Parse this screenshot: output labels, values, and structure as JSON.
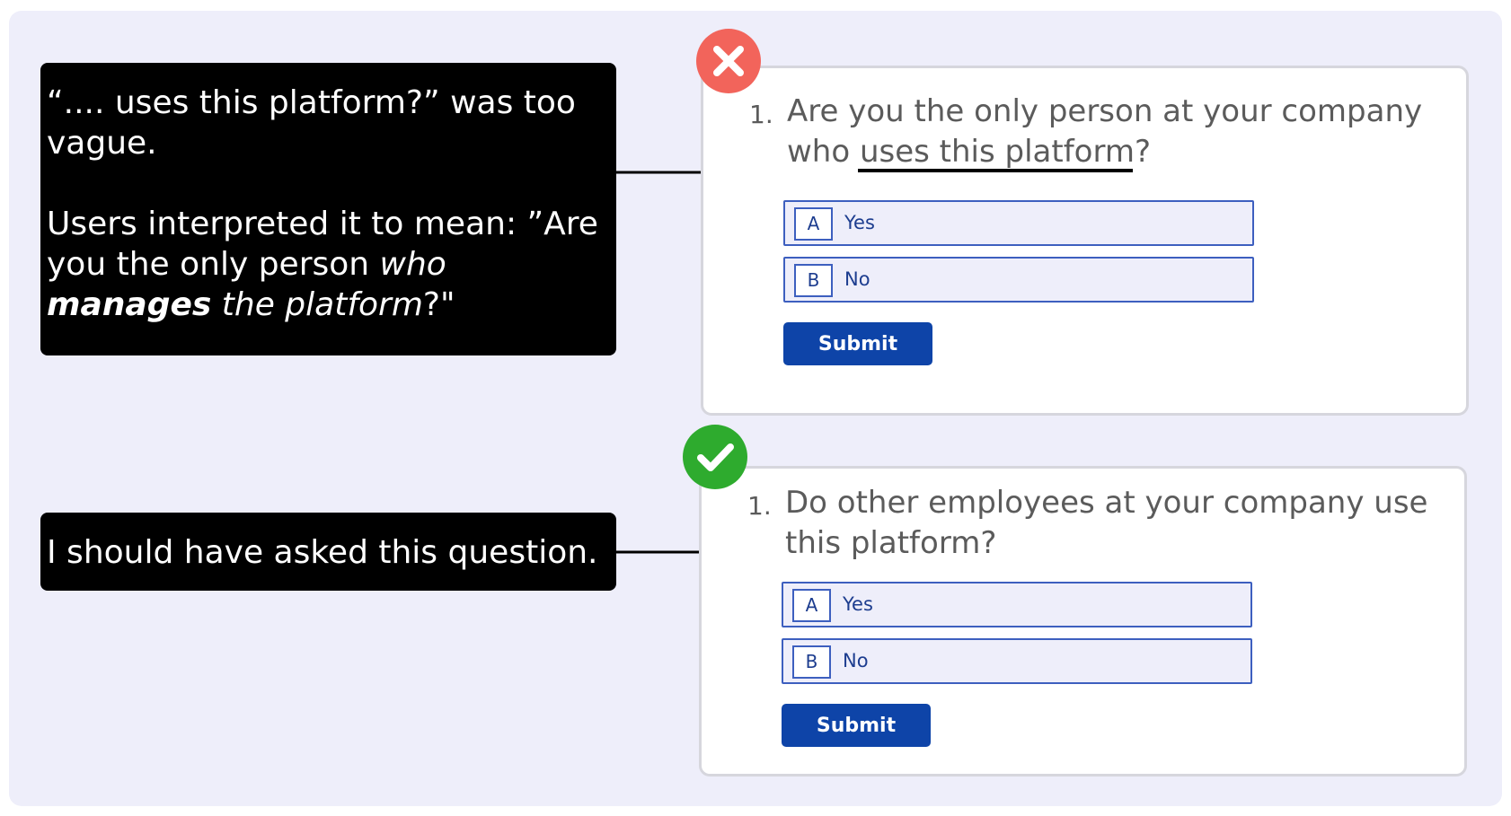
{
  "callouts": {
    "first": {
      "line1": "“.... uses this platform?” was too vague.",
      "line2_prefix": "Users interpreted it to mean: ”Are you the only person ",
      "line2_italic": "who ",
      "line2_bold_italic": "manages",
      "line2_italic_tail": " the platform",
      "line2_suffix": "?\""
    },
    "second": {
      "text": "I should have asked this question."
    }
  },
  "cards": {
    "wrong": {
      "status_icon": "x-mark-icon",
      "status_color": "#f2645b",
      "question_number": "1.",
      "question_text": "Are you the only person at your company who uses this platform?",
      "options": [
        {
          "key": "A",
          "label": "Yes"
        },
        {
          "key": "B",
          "label": "No"
        }
      ],
      "submit_label": "Submit"
    },
    "right": {
      "status_icon": "check-mark-icon",
      "status_color": "#2eab2e",
      "question_number": "1.",
      "question_text": "Do other employees at your company use this platform?",
      "options": [
        {
          "key": "A",
          "label": "Yes"
        },
        {
          "key": "B",
          "label": "No"
        }
      ],
      "submit_label": "Submit"
    }
  },
  "colors": {
    "panel_background": "#eeeefa",
    "callout_background": "#000000",
    "button_blue": "#0e44a8",
    "option_border": "#3d5fbf",
    "option_text": "#1d3d8f"
  }
}
